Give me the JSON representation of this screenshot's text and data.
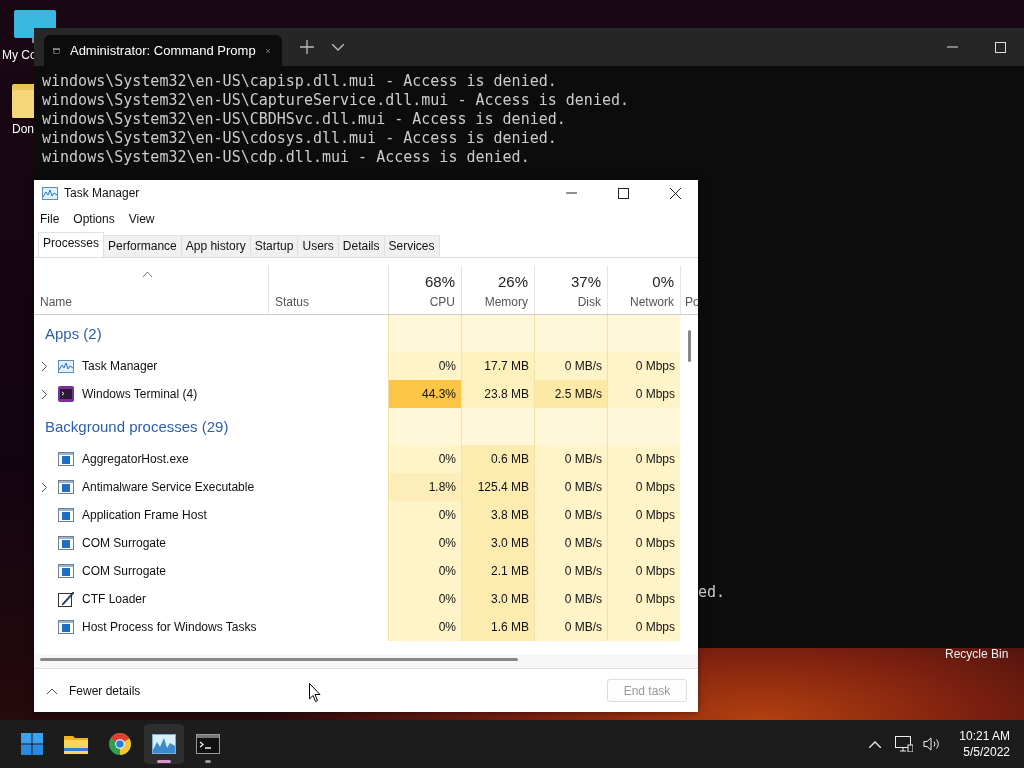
{
  "desktop": {
    "icons": [
      {
        "label": "My Co",
        "kind": "computer"
      },
      {
        "label": "Don",
        "kind": "folder"
      }
    ],
    "recycle_bin": "Recycle Bin"
  },
  "terminal": {
    "tab_title": "Administrator: Command Promp",
    "lines": [
      "windows\\System32\\en-US\\capisp.dll.mui - Access is denied.",
      "windows\\System32\\en-US\\CaptureService.dll.mui - Access is denied.",
      "windows\\System32\\en-US\\CBDHSvc.dll.mui - Access is denied.",
      "windows\\System32\\en-US\\cdosys.dll.mui - Access is denied.",
      "windows\\System32\\en-US\\cdp.dll.mui - Access is denied."
    ],
    "fragment": "ed."
  },
  "task_manager": {
    "title": "Task Manager",
    "menu": [
      "File",
      "Options",
      "View"
    ],
    "tabs": [
      {
        "label": "Processes",
        "selected": true
      },
      {
        "label": "Performance",
        "selected": false
      },
      {
        "label": "App history",
        "selected": false
      },
      {
        "label": "Startup",
        "selected": false
      },
      {
        "label": "Users",
        "selected": false
      },
      {
        "label": "Details",
        "selected": false
      },
      {
        "label": "Services",
        "selected": false
      }
    ],
    "columns": [
      {
        "label": "Name",
        "sorted": true
      },
      {
        "label": "Status",
        "sorted": false
      },
      {
        "label": "CPU",
        "usage": "68%",
        "sorted": false
      },
      {
        "label": "Memory",
        "usage": "26%",
        "sorted": false
      },
      {
        "label": "Disk",
        "usage": "37%",
        "sorted": false
      },
      {
        "label": "Network",
        "usage": "0%",
        "sorted": false
      },
      {
        "label": "Po",
        "sorted": false
      }
    ],
    "groups": [
      {
        "title": "Apps (2)",
        "rows": [
          {
            "name": "Task Manager",
            "kind": "chart",
            "expandable": true,
            "cells": [
              {
                "value": "0%",
                "color": "#fff4c8"
              },
              {
                "value": "17.7 MB",
                "color": "#fff1bd"
              },
              {
                "value": "0 MB/s",
                "color": "#fff4c8"
              },
              {
                "value": "0 Mbps",
                "color": "#fff4c8"
              }
            ]
          },
          {
            "name": "Windows Terminal (4)",
            "kind": "terminal",
            "expandable": true,
            "cells": [
              {
                "value": "44.3%",
                "color": "#fdc546"
              },
              {
                "value": "23.8 MB",
                "color": "#fff1bd"
              },
              {
                "value": "2.5 MB/s",
                "color": "#fde9a6"
              },
              {
                "value": "0 Mbps",
                "color": "#fff4c8"
              }
            ]
          }
        ]
      },
      {
        "title": "Background processes (29)",
        "rows": [
          {
            "name": "AggregatorHost.exe",
            "kind": "service",
            "expandable": false,
            "cells": [
              {
                "value": "0%",
                "color": "#fff4c8"
              },
              {
                "value": "0.6 MB",
                "color": "#fcecb0"
              },
              {
                "value": "0 MB/s",
                "color": "#fff4c8"
              },
              {
                "value": "0 Mbps",
                "color": "#fff4c8"
              }
            ]
          },
          {
            "name": "Antimalware Service Executable",
            "kind": "service",
            "expandable": true,
            "cells": [
              {
                "value": "1.8%",
                "color": "#fdedb8"
              },
              {
                "value": "125.4 MB",
                "color": "#fcecb0"
              },
              {
                "value": "0 MB/s",
                "color": "#fff4c8"
              },
              {
                "value": "0 Mbps",
                "color": "#fff4c8"
              }
            ]
          },
          {
            "name": "Application Frame Host",
            "kind": "service",
            "expandable": false,
            "cells": [
              {
                "value": "0%",
                "color": "#fff4c8"
              },
              {
                "value": "3.8 MB",
                "color": "#fcecb0"
              },
              {
                "value": "0 MB/s",
                "color": "#fff4c8"
              },
              {
                "value": "0 Mbps",
                "color": "#fff4c8"
              }
            ]
          },
          {
            "name": "COM Surrogate",
            "kind": "service",
            "expandable": false,
            "cells": [
              {
                "value": "0%",
                "color": "#fff4c8"
              },
              {
                "value": "3.0 MB",
                "color": "#fcecb0"
              },
              {
                "value": "0 MB/s",
                "color": "#fff4c8"
              },
              {
                "value": "0 Mbps",
                "color": "#fff4c8"
              }
            ]
          },
          {
            "name": "COM Surrogate",
            "kind": "service",
            "expandable": false,
            "cells": [
              {
                "value": "0%",
                "color": "#fff4c8"
              },
              {
                "value": "2.1 MB",
                "color": "#fcecb0"
              },
              {
                "value": "0 MB/s",
                "color": "#fff4c8"
              },
              {
                "value": "0 Mbps",
                "color": "#fff4c8"
              }
            ]
          },
          {
            "name": "CTF Loader",
            "kind": "pen",
            "expandable": false,
            "cells": [
              {
                "value": "0%",
                "color": "#fff4c8"
              },
              {
                "value": "3.0 MB",
                "color": "#fcecb0"
              },
              {
                "value": "0 MB/s",
                "color": "#fff4c8"
              },
              {
                "value": "0 Mbps",
                "color": "#fff4c8"
              }
            ]
          },
          {
            "name": "Host Process for Windows Tasks",
            "kind": "service",
            "expandable": false,
            "cells": [
              {
                "value": "0%",
                "color": "#fff4c8"
              },
              {
                "value": "1.6 MB",
                "color": "#fcecb0"
              },
              {
                "value": "0 MB/s",
                "color": "#fff4c8"
              },
              {
                "value": "0 Mbps",
                "color": "#fff4c8"
              }
            ]
          }
        ]
      }
    ],
    "fewer_details": "Fewer details",
    "end_task": {
      "label": "End task",
      "disabled": true
    }
  },
  "taskbar": {
    "apps": [
      {
        "kind": "start",
        "open": false,
        "selected": false
      },
      {
        "kind": "folder",
        "open": false,
        "selected": false
      },
      {
        "kind": "browser",
        "open": false,
        "selected": false
      },
      {
        "kind": "chart",
        "open": true,
        "selected": true
      },
      {
        "kind": "terminal",
        "open": true,
        "selected": false
      }
    ],
    "time": "10:21 AM",
    "date": "5/5/2022"
  }
}
